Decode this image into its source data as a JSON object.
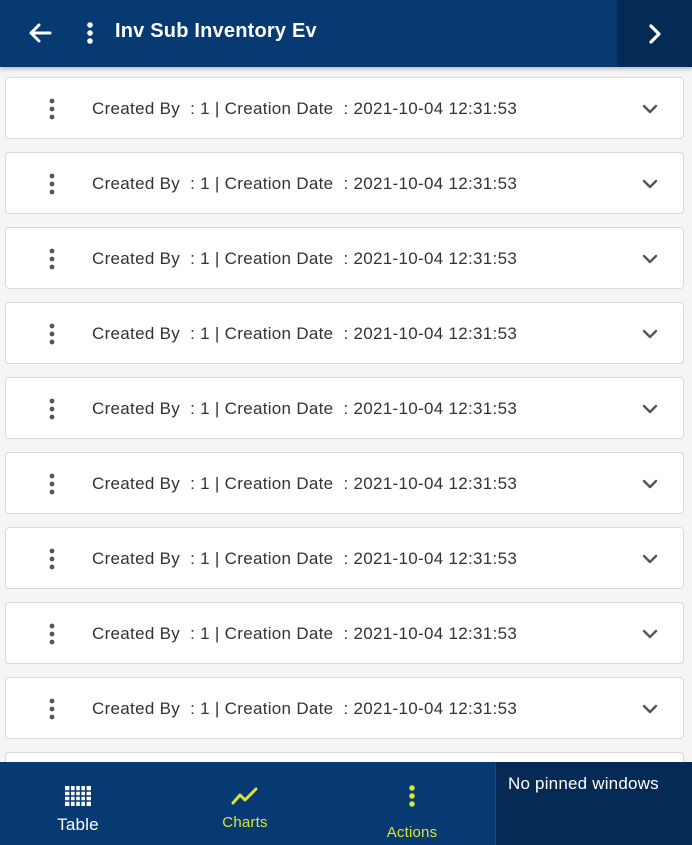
{
  "header": {
    "title": "Inv Sub Inventory Ev",
    "icons": {
      "back": "arrow-left-icon",
      "menu": "more-vertical-icon",
      "next": "chevron-right-icon"
    }
  },
  "list": {
    "rows": [
      {
        "text": "Created By  : 1 | Creation Date  : 2021-10-04 12:31:53"
      },
      {
        "text": "Created By  : 1 | Creation Date  : 2021-10-04 12:31:53"
      },
      {
        "text": "Created By  : 1 | Creation Date  : 2021-10-04 12:31:53"
      },
      {
        "text": "Created By  : 1 | Creation Date  : 2021-10-04 12:31:53"
      },
      {
        "text": "Created By  : 1 | Creation Date  : 2021-10-04 12:31:53"
      },
      {
        "text": "Created By  : 1 | Creation Date  : 2021-10-04 12:31:53"
      },
      {
        "text": "Created By  : 1 | Creation Date  : 2021-10-04 12:31:53"
      },
      {
        "text": "Created By  : 1 | Creation Date  : 2021-10-04 12:31:53"
      },
      {
        "text": "Created By  : 1 | Creation Date  : 2021-10-04 12:31:53"
      },
      {
        "text": ""
      }
    ]
  },
  "bottom_nav": {
    "table_label": "Table",
    "charts_label": "Charts",
    "actions_label": "Actions",
    "pinned_text": "No pinned windows"
  },
  "colors": {
    "header_bg": "#073a73",
    "header_dark": "#052a55",
    "accent_yellow": "#d9e53a",
    "card_border": "#d9d9d9"
  }
}
